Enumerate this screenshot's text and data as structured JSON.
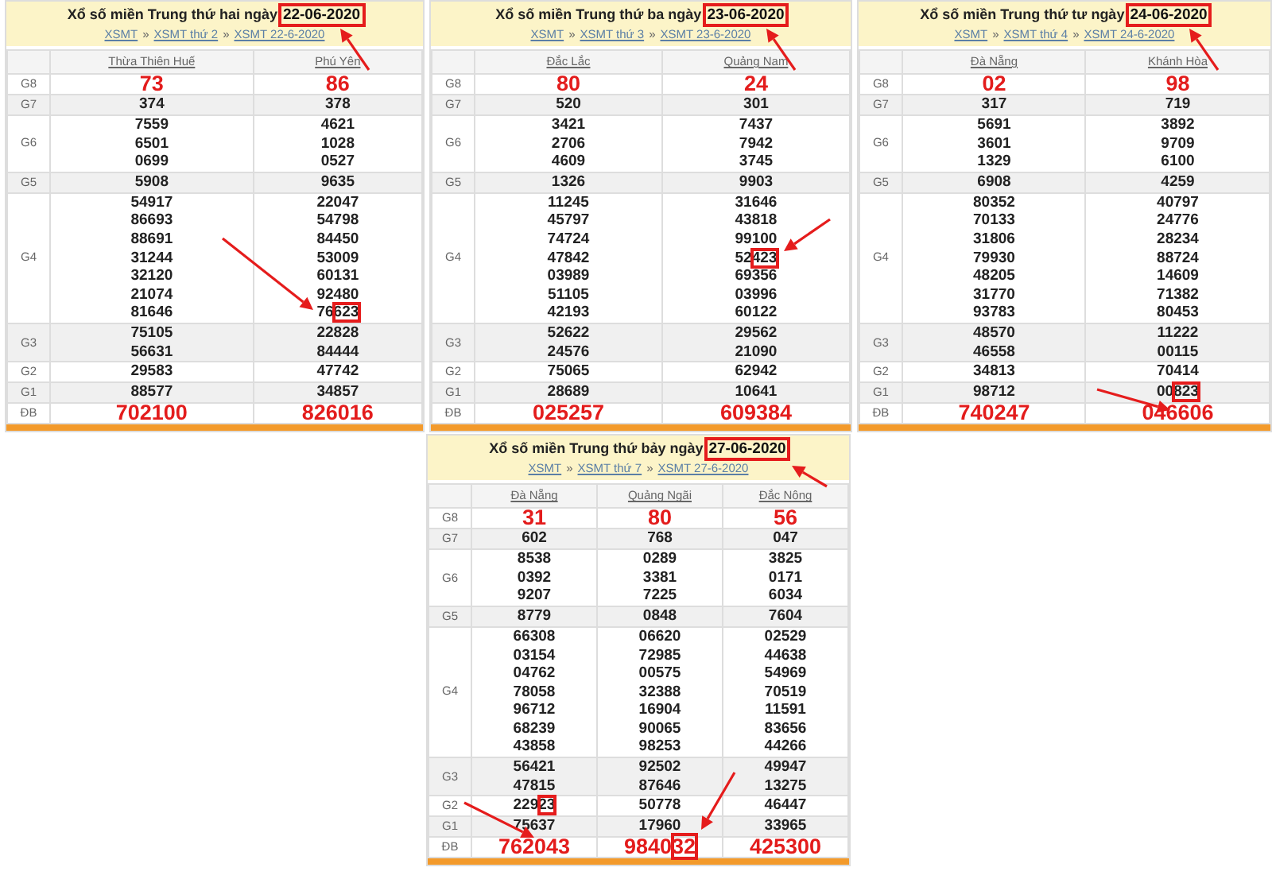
{
  "tables": [
    {
      "title": "Xổ số miền Trung thứ hai ngày",
      "date": "22-06-2020",
      "date_boxed": true,
      "breadcrumb": [
        "XSMT",
        "XSMT thứ 2",
        "XSMT 22-6-2020"
      ],
      "separator": "»",
      "provinces": [
        "Thừa Thiên Huế",
        "Phú Yên"
      ],
      "prizes": [
        {
          "label": "G8",
          "kind": "headline",
          "values": [
            [
              "73"
            ],
            [
              "86"
            ]
          ]
        },
        {
          "label": "G7",
          "kind": "normal",
          "values": [
            [
              "374"
            ],
            [
              "378"
            ]
          ]
        },
        {
          "label": "G6",
          "kind": "normal",
          "values": [
            [
              "7559",
              "6501",
              "0699"
            ],
            [
              "4621",
              "1028",
              "0527"
            ]
          ]
        },
        {
          "label": "G5",
          "kind": "normal",
          "values": [
            [
              "5908"
            ],
            [
              "9635"
            ]
          ]
        },
        {
          "label": "G4",
          "kind": "normal",
          "values": [
            [
              "54917",
              "86693",
              "88691",
              "31244",
              "32120",
              "21074",
              "81646"
            ],
            [
              "22047",
              "54798",
              "84450",
              "53009",
              "60131",
              "92480",
              {
                "head": "76",
                "boxed": "623"
              }
            ]
          ]
        },
        {
          "label": "G3",
          "kind": "normal",
          "values": [
            [
              "75105",
              "56631"
            ],
            [
              "22828",
              "84444"
            ]
          ]
        },
        {
          "label": "G2",
          "kind": "normal",
          "values": [
            [
              "29583"
            ],
            [
              "47742"
            ]
          ]
        },
        {
          "label": "G1",
          "kind": "normal",
          "values": [
            [
              "88577"
            ],
            [
              "34857"
            ]
          ]
        },
        {
          "label": "ĐB",
          "kind": "headline",
          "values": [
            [
              "702100"
            ],
            [
              "826016"
            ]
          ]
        }
      ]
    },
    {
      "title": "Xổ số miền Trung thứ ba ngày",
      "date": "23-06-2020",
      "date_boxed": true,
      "breadcrumb": [
        "XSMT",
        "XSMT thứ 3",
        "XSMT 23-6-2020"
      ],
      "separator": "»",
      "provinces": [
        "Đắc Lắc",
        "Quảng Nam"
      ],
      "prizes": [
        {
          "label": "G8",
          "kind": "headline",
          "values": [
            [
              "80"
            ],
            [
              "24"
            ]
          ]
        },
        {
          "label": "G7",
          "kind": "normal",
          "values": [
            [
              "520"
            ],
            [
              "301"
            ]
          ]
        },
        {
          "label": "G6",
          "kind": "normal",
          "values": [
            [
              "3421",
              "2706",
              "4609"
            ],
            [
              "7437",
              "7942",
              "3745"
            ]
          ]
        },
        {
          "label": "G5",
          "kind": "normal",
          "values": [
            [
              "1326"
            ],
            [
              "9903"
            ]
          ]
        },
        {
          "label": "G4",
          "kind": "normal",
          "values": [
            [
              "11245",
              "45797",
              "74724",
              "47842",
              "03989",
              "51105",
              "42193"
            ],
            [
              "31646",
              "43818",
              "99100",
              {
                "head": "52",
                "boxed": "423"
              },
              "69356",
              "03996",
              "60122"
            ]
          ]
        },
        {
          "label": "G3",
          "kind": "normal",
          "values": [
            [
              "52622",
              "24576"
            ],
            [
              "29562",
              "21090"
            ]
          ]
        },
        {
          "label": "G2",
          "kind": "normal",
          "values": [
            [
              "75065"
            ],
            [
              "62942"
            ]
          ]
        },
        {
          "label": "G1",
          "kind": "normal",
          "values": [
            [
              "28689"
            ],
            [
              "10641"
            ]
          ]
        },
        {
          "label": "ĐB",
          "kind": "headline",
          "values": [
            [
              "025257"
            ],
            [
              "609384"
            ]
          ]
        }
      ]
    },
    {
      "title": "Xổ số miền Trung thứ tư ngày",
      "date": "24-06-2020",
      "date_boxed": true,
      "breadcrumb": [
        "XSMT",
        "XSMT thứ 4",
        "XSMT 24-6-2020"
      ],
      "separator": "»",
      "provinces": [
        "Đà Nẵng",
        "Khánh Hòa"
      ],
      "prizes": [
        {
          "label": "G8",
          "kind": "headline",
          "values": [
            [
              "02"
            ],
            [
              "98"
            ]
          ]
        },
        {
          "label": "G7",
          "kind": "normal",
          "values": [
            [
              "317"
            ],
            [
              "719"
            ]
          ]
        },
        {
          "label": "G6",
          "kind": "normal",
          "values": [
            [
              "5691",
              "3601",
              "1329"
            ],
            [
              "3892",
              "9709",
              "6100"
            ]
          ]
        },
        {
          "label": "G5",
          "kind": "normal",
          "values": [
            [
              "6908"
            ],
            [
              "4259"
            ]
          ]
        },
        {
          "label": "G4",
          "kind": "normal",
          "values": [
            [
              "80352",
              "70133",
              "31806",
              "79930",
              "48205",
              "31770",
              "93783"
            ],
            [
              "40797",
              "24776",
              "28234",
              "88724",
              "14609",
              "71382",
              "80453"
            ]
          ]
        },
        {
          "label": "G3",
          "kind": "normal",
          "values": [
            [
              "48570",
              "46558"
            ],
            [
              "11222",
              "00115"
            ]
          ]
        },
        {
          "label": "G2",
          "kind": "normal",
          "values": [
            [
              "34813"
            ],
            [
              "70414"
            ]
          ]
        },
        {
          "label": "G1",
          "kind": "normal",
          "values": [
            [
              "98712"
            ],
            [
              {
                "head": "00",
                "boxed": "823"
              }
            ]
          ]
        },
        {
          "label": "ĐB",
          "kind": "headline",
          "values": [
            [
              "740247"
            ],
            [
              "046606"
            ]
          ]
        }
      ]
    },
    {
      "title": "Xổ số miền Trung thứ bảy ngày",
      "date": "27-06-2020",
      "date_boxed": true,
      "breadcrumb": [
        "XSMT",
        "XSMT thứ 7",
        "XSMT 27-6-2020"
      ],
      "separator": "»",
      "provinces": [
        "Đà Nẵng",
        "Quảng Ngãi",
        "Đắc Nông"
      ],
      "prizes": [
        {
          "label": "G8",
          "kind": "headline",
          "values": [
            [
              "31"
            ],
            [
              "80"
            ],
            [
              "56"
            ]
          ]
        },
        {
          "label": "G7",
          "kind": "normal",
          "values": [
            [
              "602"
            ],
            [
              "768"
            ],
            [
              "047"
            ]
          ]
        },
        {
          "label": "G6",
          "kind": "normal",
          "values": [
            [
              "8538",
              "0392",
              "9207"
            ],
            [
              "0289",
              "3381",
              "7225"
            ],
            [
              "3825",
              "0171",
              "6034"
            ]
          ]
        },
        {
          "label": "G5",
          "kind": "normal",
          "values": [
            [
              "8779"
            ],
            [
              "0848"
            ],
            [
              "7604"
            ]
          ]
        },
        {
          "label": "G4",
          "kind": "normal",
          "values": [
            [
              "66308",
              "03154",
              "04762",
              "78058",
              "96712",
              "68239",
              "43858"
            ],
            [
              "06620",
              "72985",
              "00575",
              "32388",
              "16904",
              "90065",
              "98253"
            ],
            [
              "02529",
              "44638",
              "54969",
              "70519",
              "11591",
              "83656",
              "44266"
            ]
          ]
        },
        {
          "label": "G3",
          "kind": "normal",
          "values": [
            [
              "56421",
              "47815"
            ],
            [
              "92502",
              "87646"
            ],
            [
              "49947",
              "13275"
            ]
          ]
        },
        {
          "label": "G2",
          "kind": "normal",
          "values": [
            [
              {
                "head": "229",
                "boxed": "23"
              }
            ],
            [
              "50778"
            ],
            [
              "46447"
            ]
          ]
        },
        {
          "label": "G1",
          "kind": "normal",
          "values": [
            [
              "75637"
            ],
            [
              "17960"
            ],
            [
              "33965"
            ]
          ]
        },
        {
          "label": "ĐB",
          "kind": "headline",
          "values": [
            [
              "762043"
            ],
            [
              {
                "head": "9840",
                "boxed": "32"
              }
            ],
            [
              "425300"
            ]
          ]
        }
      ]
    }
  ]
}
